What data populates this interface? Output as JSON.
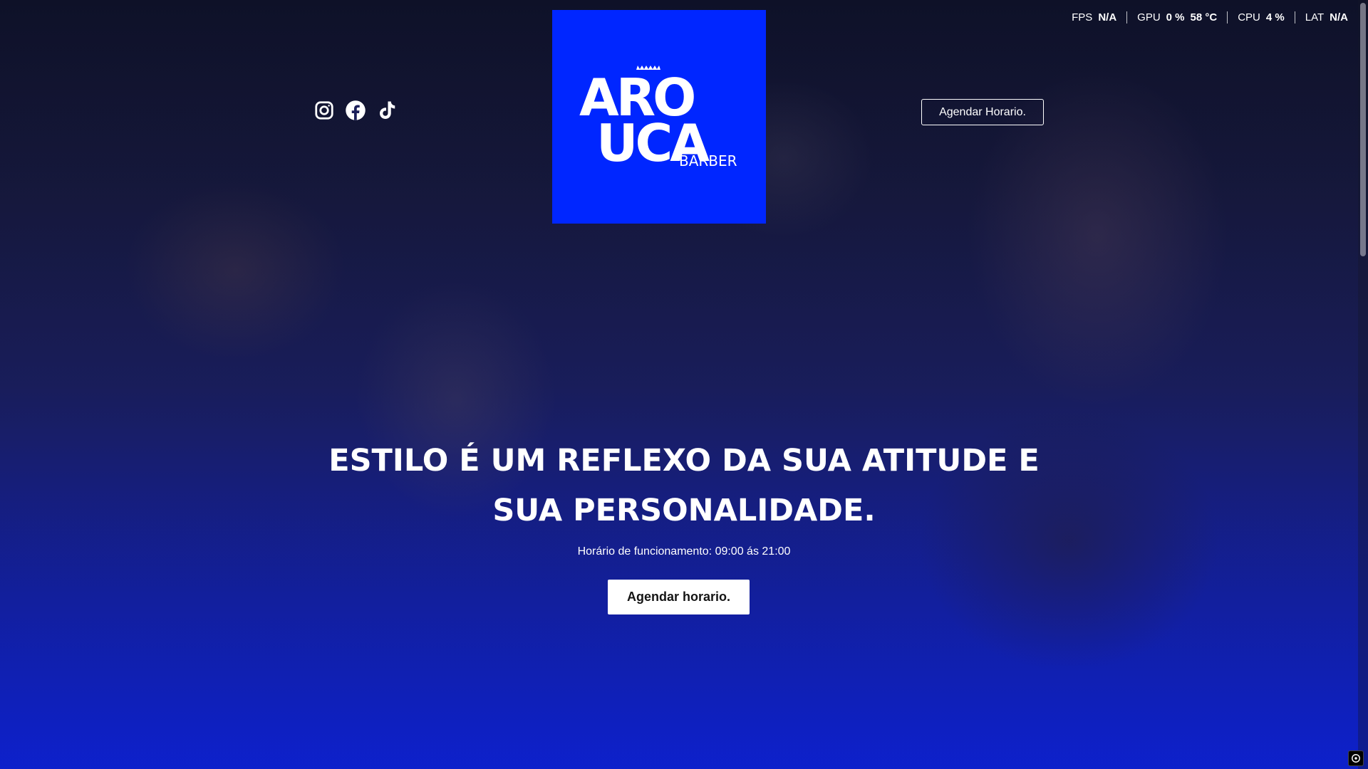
{
  "overlay": {
    "metrics": [
      {
        "key": "FPS",
        "values": [
          "N/A"
        ]
      },
      {
        "key": "GPU",
        "values": [
          "0 %",
          "58 °C"
        ]
      },
      {
        "key": "CPU",
        "values": [
          "4 %"
        ]
      },
      {
        "key": "LAT",
        "values": [
          "N/A"
        ]
      }
    ]
  },
  "header": {
    "socials": [
      {
        "name": "instagram",
        "icon": "instagram-icon"
      },
      {
        "name": "facebook",
        "icon": "facebook-icon"
      },
      {
        "name": "tiktok",
        "icon": "tiktok-icon"
      }
    ],
    "logo": {
      "line1": "ARO",
      "line2": "UCA",
      "tagline": "BARBER",
      "background": "#0026ff"
    },
    "cta_label": "Agendar Horario."
  },
  "hero": {
    "title_line1": "ESTILO É UM REFLEXO DA SUA ATITUDE E",
    "title_line2": "SUA PERSONALIDADE.",
    "hours": "Horário de funcionamento: 09:00 ás 21:00",
    "cta_label": "Agendar horario."
  },
  "colors": {
    "brand_blue": "#0026ff",
    "text": "#ffffff",
    "cta_bg": "#ffffff",
    "cta_text": "#141414"
  }
}
